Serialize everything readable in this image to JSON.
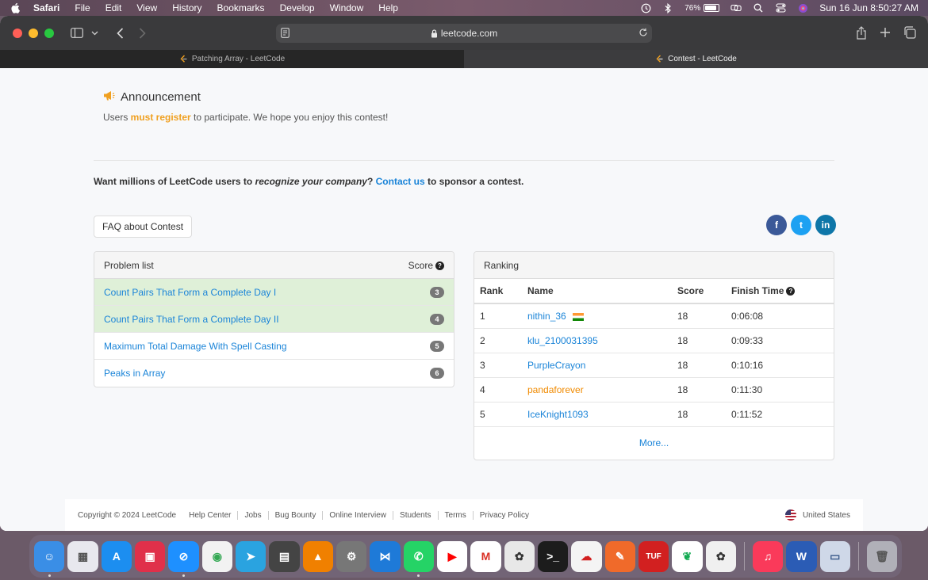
{
  "menubar": {
    "app_name": "Safari",
    "items": [
      "File",
      "Edit",
      "View",
      "History",
      "Bookmarks",
      "Develop",
      "Window",
      "Help"
    ],
    "battery": "76%",
    "datetime": "Sun 16 Jun  8:50:27 AM"
  },
  "browser": {
    "url": "leetcode.com",
    "tabs": [
      {
        "label": "Patching Array - LeetCode",
        "active": false
      },
      {
        "label": "Contest - LeetCode",
        "active": true
      }
    ]
  },
  "announcement": {
    "title": "Announcement",
    "text_before": "Users ",
    "highlight": "must register",
    "text_after": " to participate. We hope you enjoy this contest!"
  },
  "sponsor": {
    "part1": "Want millions of LeetCode users to ",
    "italic": "recognize your company",
    "part2": "? ",
    "link": "Contact us",
    "part3": " to sponsor a contest."
  },
  "faq_button": "FAQ about Contest",
  "social": [
    {
      "icon": "facebook-icon",
      "glyph": "f",
      "color": "#3b5998"
    },
    {
      "icon": "twitter-icon",
      "glyph": "t",
      "color": "#1da1f2"
    },
    {
      "icon": "linkedin-icon",
      "glyph": "in",
      "color": "#0e76a8"
    }
  ],
  "problem_list": {
    "title": "Problem list",
    "score_label": "Score",
    "items": [
      {
        "title": "Count Pairs That Form a Complete Day I",
        "score": "3",
        "solved": true
      },
      {
        "title": "Count Pairs That Form a Complete Day II",
        "score": "4",
        "solved": true
      },
      {
        "title": "Maximum Total Damage With Spell Casting",
        "score": "5",
        "solved": false
      },
      {
        "title": "Peaks in Array",
        "score": "6",
        "solved": false
      }
    ]
  },
  "ranking": {
    "title": "Ranking",
    "columns": {
      "rank": "Rank",
      "name": "Name",
      "score": "Score",
      "finish": "Finish Time"
    },
    "rows": [
      {
        "rank": "1",
        "name": "nithin_36",
        "score": "18",
        "finish": "0:06:08",
        "flag": "india",
        "color": "blue"
      },
      {
        "rank": "2",
        "name": "klu_2100031395",
        "score": "18",
        "finish": "0:09:33",
        "flag": "",
        "color": "blue"
      },
      {
        "rank": "3",
        "name": "PurpleCrayon",
        "score": "18",
        "finish": "0:10:16",
        "flag": "",
        "color": "blue"
      },
      {
        "rank": "4",
        "name": "pandaforever",
        "score": "18",
        "finish": "0:11:30",
        "flag": "",
        "color": "orange"
      },
      {
        "rank": "5",
        "name": "IceKnight1093",
        "score": "18",
        "finish": "0:11:52",
        "flag": "",
        "color": "blue"
      }
    ],
    "more": "More..."
  },
  "footer": {
    "copyright": "Copyright © 2024 LeetCode",
    "links": [
      "Help Center",
      "Jobs",
      "Bug Bounty",
      "Online Interview",
      "Students",
      "Terms",
      "Privacy Policy"
    ],
    "country": "United States"
  },
  "dock": [
    {
      "name": "finder",
      "color": "#3a8ee6",
      "glyph": "☺",
      "running": true
    },
    {
      "name": "launchpad",
      "color": "#e8e8ee",
      "glyph": "▦",
      "running": false
    },
    {
      "name": "app-store",
      "color": "#1c8ef0",
      "glyph": "A",
      "running": false
    },
    {
      "name": "photo-booth",
      "color": "#e0304a",
      "glyph": "▣",
      "running": false
    },
    {
      "name": "safari",
      "color": "#1e90ff",
      "glyph": "⊘",
      "running": true
    },
    {
      "name": "chrome",
      "color": "#f2f2f2",
      "glyph": "◉",
      "running": false
    },
    {
      "name": "telegram",
      "color": "#2aa3e0",
      "glyph": "➤",
      "running": false
    },
    {
      "name": "calculator",
      "color": "#444",
      "glyph": "▤",
      "running": false
    },
    {
      "name": "vlc",
      "color": "#f08000",
      "glyph": "▲",
      "running": false
    },
    {
      "name": "system-settings",
      "color": "#777",
      "glyph": "⚙",
      "running": false
    },
    {
      "name": "vscode",
      "color": "#1e7ad8",
      "glyph": "⋈",
      "running": false
    },
    {
      "name": "whatsapp",
      "color": "#25d366",
      "glyph": "✆",
      "running": true
    },
    {
      "name": "youtube",
      "color": "#ffffff",
      "glyph": "▶",
      "running": false
    },
    {
      "name": "gmail",
      "color": "#ffffff",
      "glyph": "M",
      "running": false
    },
    {
      "name": "chatgpt",
      "color": "#e8e8e8",
      "glyph": "✿",
      "running": false
    },
    {
      "name": "terminal",
      "color": "#1c1c1c",
      "glyph": ">_",
      "running": false
    },
    {
      "name": "cloud-app",
      "color": "#f4f4f4",
      "glyph": "☁",
      "running": false
    },
    {
      "name": "pen-app",
      "color": "#f06a2a",
      "glyph": "✎",
      "running": false
    },
    {
      "name": "tuf-app",
      "color": "#d22020",
      "glyph": "TUF",
      "running": false
    },
    {
      "name": "mongodb-compass",
      "color": "#ffffff",
      "glyph": "❦",
      "running": false
    },
    {
      "name": "openai-app",
      "color": "#f0f0f0",
      "glyph": "✿",
      "running": false
    },
    {
      "name": "music",
      "color": "#fa3a5a",
      "glyph": "♫",
      "running": false
    },
    {
      "name": "word",
      "color": "#2b5cb5",
      "glyph": "W",
      "running": false
    },
    {
      "name": "preview",
      "color": "#cfd8e8",
      "glyph": "▭",
      "running": false
    },
    {
      "name": "trash",
      "color": "#b0b0b8",
      "glyph": "🗑",
      "running": false
    }
  ]
}
